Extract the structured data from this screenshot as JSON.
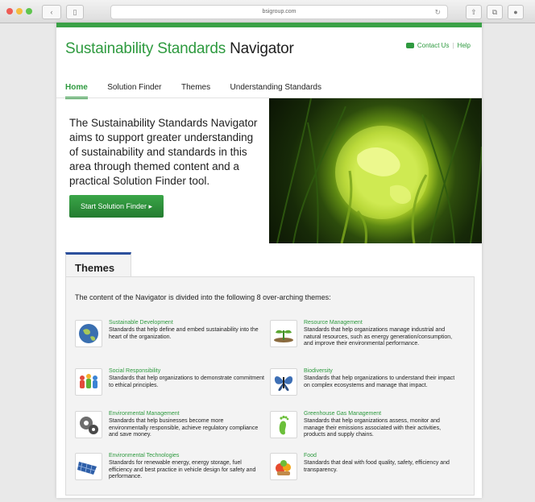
{
  "browser": {
    "address": "bsigroup.com",
    "back_glyph": "‹",
    "sidebar_glyph": "▯",
    "reload_glyph": "↻",
    "share_glyph": "⇧",
    "tabs_glyph": "⧉",
    "extra_glyph": "●"
  },
  "header": {
    "title_green": "Sustainability Standards",
    "title_dark": "Navigator",
    "contact_label": "Contact Us",
    "separator": "|",
    "help_label": "Help"
  },
  "nav": {
    "items": [
      {
        "label": "Home",
        "active": true
      },
      {
        "label": "Solution Finder",
        "active": false
      },
      {
        "label": "Themes",
        "active": false
      },
      {
        "label": "Understanding Standards",
        "active": false
      }
    ]
  },
  "hero": {
    "text": "The Sustainability Standards Navigator aims to support greater understanding of sustainability and standards in this area through themed content and a practical Solution Finder tool.",
    "cta_label": "Start Solution Finder ▸"
  },
  "themes": {
    "tab_label": "Themes",
    "intro": "The content of the Navigator is divided into the following 8 over-arching themes:",
    "items": [
      {
        "title": "Sustainable Development",
        "desc": "Standards that help define and embed sustainability into the heart of the organization.",
        "icon": "globe-icon"
      },
      {
        "title": "Resource Management",
        "desc": "Standards that help organizations manage industrial and natural resources, such as energy generation/consumption, and improve their environmental performance.",
        "icon": "seedling-icon"
      },
      {
        "title": "Social Responsibility",
        "desc": "Standards that help organizations to demonstrate commitment to ethical principles.",
        "icon": "people-icon"
      },
      {
        "title": "Biodiversity",
        "desc": "Standards that help organizations to understand their impact on complex ecosystems and manage that impact.",
        "icon": "butterfly-icon"
      },
      {
        "title": "Environmental Management",
        "desc": "Standards that help businesses become more environmentally responsible, achieve regulatory compliance and save money.",
        "icon": "gears-icon"
      },
      {
        "title": "Greenhouse Gas Management",
        "desc": "Standards that help organizations assess, monitor and manage their emissions associated with their activities, products and supply chains.",
        "icon": "footprint-icon"
      },
      {
        "title": "Environmental Technologies",
        "desc": "Standards for renewable energy, energy storage, fuel efficiency and best practice in vehicle design for safety and performance.",
        "icon": "solar-panel-icon"
      },
      {
        "title": "Food",
        "desc": "Standards that deal with food quality, safety, efficiency and transparency.",
        "icon": "food-icon"
      }
    ]
  }
}
